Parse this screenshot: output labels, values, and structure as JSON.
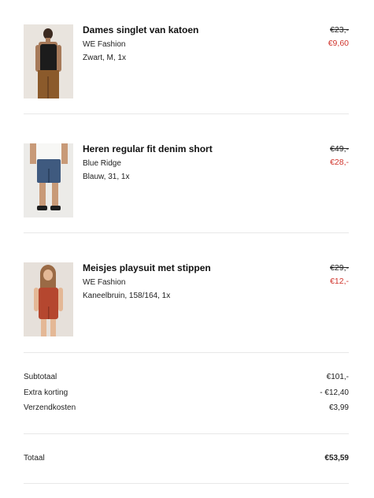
{
  "items": [
    {
      "name": "Dames singlet van katoen",
      "brand": "WE Fashion",
      "variant": "Zwart, M, 1x",
      "old_price": "€23,-",
      "new_price": "€9,60",
      "image": "woman-black-singlet-photo"
    },
    {
      "name": "Heren regular fit denim short",
      "brand": "Blue Ridge",
      "variant": "Blauw, 31, 1x",
      "old_price": "€49,-",
      "new_price": "€28,-",
      "image": "man-denim-short-photo"
    },
    {
      "name": "Meisjes playsuit met stippen",
      "brand": "WE Fashion",
      "variant": "Kaneelbruin, 158/164, 1x",
      "old_price": "€29,-",
      "new_price": "€12,-",
      "image": "girl-playsuit-photo"
    }
  ],
  "summary": {
    "subtotal_label": "Subtotaal",
    "subtotal_value": "€101,-",
    "discount_label": "Extra korting",
    "discount_value": "- €12,40",
    "shipping_label": "Verzendkosten",
    "shipping_value": "€3,99",
    "total_label": "Totaal",
    "total_value": "€53,59"
  },
  "colors": {
    "sale_price": "#d0342c",
    "divider": "#e8e8e8"
  }
}
